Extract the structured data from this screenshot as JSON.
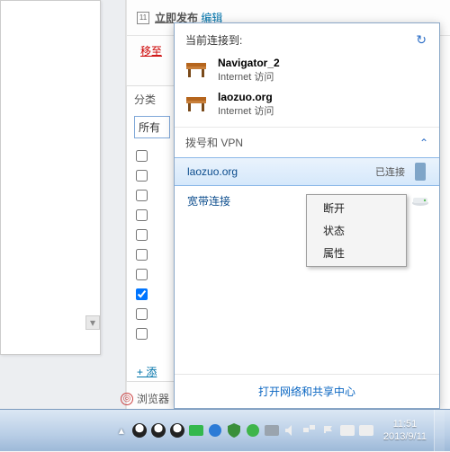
{
  "background": {
    "publish_label": "立即发布",
    "edit_link": "编辑",
    "move_to": "移至",
    "category_header": "分类",
    "category_selected": "所有",
    "add_link": "+ 添",
    "browse_label": "浏览器"
  },
  "flyout": {
    "header": "当前连接到:",
    "networks": [
      {
        "name": "Navigator_2",
        "status": "Internet 访问"
      },
      {
        "name": "laozuo.org",
        "status": "Internet 访问"
      }
    ],
    "section_label": "拨号和 VPN",
    "connections": [
      {
        "name": "laozuo.org",
        "state": "已连接",
        "selected": true
      },
      {
        "name": "宽带连接",
        "state": "",
        "selected": false
      }
    ],
    "footer_link": "打开网络和共享中心"
  },
  "context_menu": {
    "items": [
      "断开",
      "状态",
      "属性"
    ]
  },
  "taskbar": {
    "time": "11:51",
    "date": "2013/9/11"
  },
  "tray_icons": [
    "qq",
    "qq",
    "qq",
    "green-u",
    "globe-blue",
    "shield",
    "360",
    "printer",
    "speaker",
    "network",
    "flag",
    "power",
    "ime"
  ]
}
